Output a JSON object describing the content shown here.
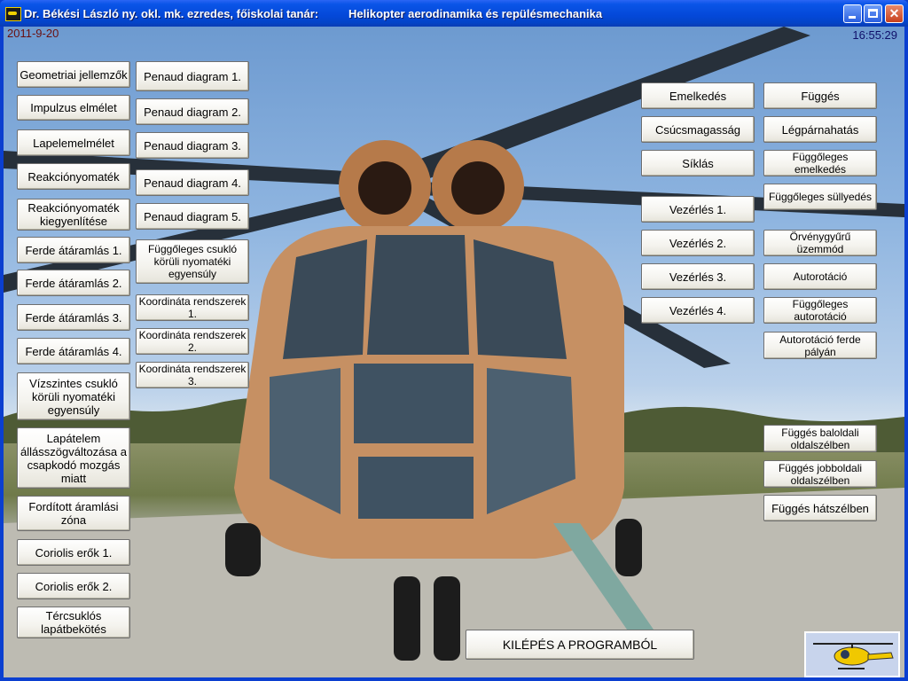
{
  "window": {
    "title_left": "Dr. Békési László ny. okl. mk. ezredes, főiskolai tanár:",
    "title_right": "Helikopter aerodinamika és repülésmechanika"
  },
  "status": {
    "date": "2011-9-20",
    "time": "16:55:29"
  },
  "left_col1": [
    "Geometriai jellemzők",
    "Impulzus elmélet",
    "Lapelemelmélet",
    "Reakciónyomaték",
    "Reakciónyomaték kiegyenlítése",
    "Ferde átáramlás 1.",
    "Ferde átáramlás 2.",
    "Ferde átáramlás 3.",
    "Ferde átáramlás 4.",
    "Vízszintes csukló körüli nyomatéki egyensúly",
    "Lapátelem állásszögváltozása a csapkodó mozgás miatt",
    "Fordított áramlási zóna",
    "Coriolis erők 1.",
    "Coriolis erők 2.",
    "Tércsuklós lapátbekötés"
  ],
  "left_col2": [
    "Penaud diagram 1.",
    "Penaud diagram 2.",
    "Penaud diagram 3.",
    "Penaud diagram 4.",
    "Penaud diagram 5.",
    "Függőleges csukló körüli nyomatéki egyensúly",
    "Koordináta rendszerek 1.",
    "Koordináta rendszerek 2.",
    "Koordináta rendszerek 3."
  ],
  "right_col1": [
    "Emelkedés",
    "Csúcsmagasság",
    "Síklás",
    "Vezérlés 1.",
    "Vezérlés 2.",
    "Vezérlés 3.",
    "Vezérlés 4."
  ],
  "right_col2": [
    "Függés",
    "Légpárnahatás",
    "Függőleges emelkedés",
    "Függőleges süllyedés",
    "Örvénygyűrű üzemmód",
    "Autorotáció",
    "Függőleges autorotáció",
    "Autorotáció ferde pályán",
    "Függés baloldali oldalszélben",
    "Függés jobboldali oldalszélben",
    "Függés hátszélben"
  ],
  "exit_button": "KILÉPÉS A PROGRAMBÓL"
}
